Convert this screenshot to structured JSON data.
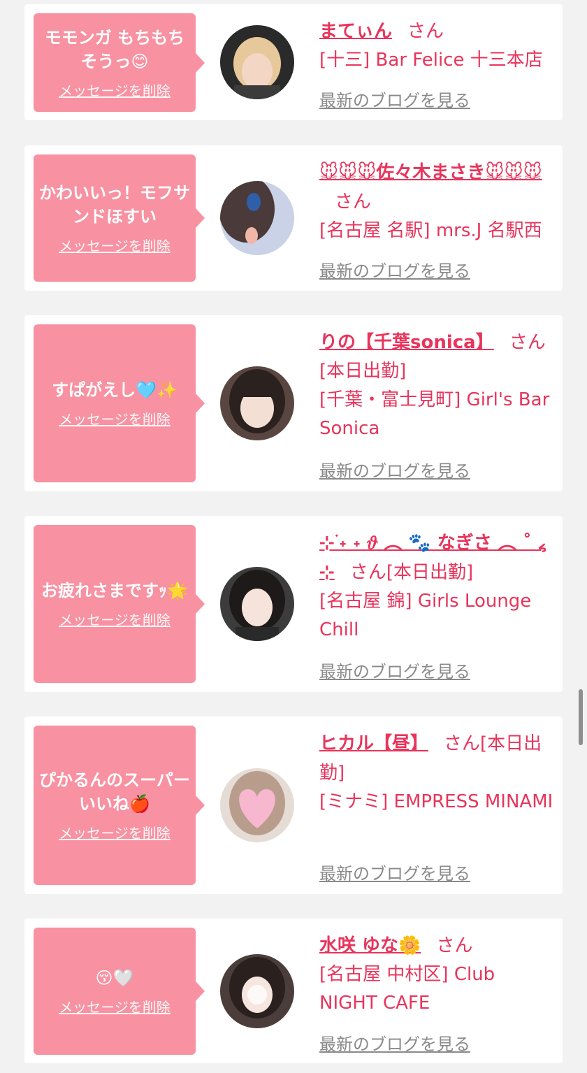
{
  "delete_label": "メッセージを削除",
  "blog_label": "最新のブログを見る",
  "san_label": "さん",
  "cards": [
    {
      "message": "モモンガ もちもち そうっ😊",
      "name": "まてぃん",
      "details": [
        "[十三] Bar Felice 十三本店"
      ]
    },
    {
      "message": "かわいいっ！モフサンドほすい",
      "name": "🐭🐭🐭佐々木まさき🐭🐭🐭",
      "details": [
        "[名古屋 名駅] mrs.J 名駅西"
      ]
    },
    {
      "message": "すぱがえし🩵✨",
      "name": "りの【千葉sonica】",
      "details": [
        "[本日出勤]",
        "[千葉・富士見町] Girl's Bar Sonica"
      ]
    },
    {
      "message": "お疲れさまですｯ🌟",
      "name": "⊹ ࣪˖ ˖ 𝜗 ︵ 🐾 なぎさ ︵ ˚ ៹ ⊹",
      "details": [
        "[本日出勤]",
        "[名古屋 錦] Girls Lounge Chill"
      ]
    },
    {
      "message": "ぴかるんのスーパーいいね🍎",
      "name": "ヒカル【昼】",
      "details": [
        "[本日出勤]",
        "[ミナミ] EMPRESS MINAMI"
      ]
    },
    {
      "message": "😚🤍",
      "name": "水咲 ゆな🌼",
      "details": [
        "[名古屋 中村区] Club NIGHT CAFE"
      ]
    }
  ],
  "colors": {
    "accent": "#e8345b",
    "bubble": "#f891a1",
    "link_gray": "#8a8a8a",
    "background": "#f2f2f2"
  }
}
